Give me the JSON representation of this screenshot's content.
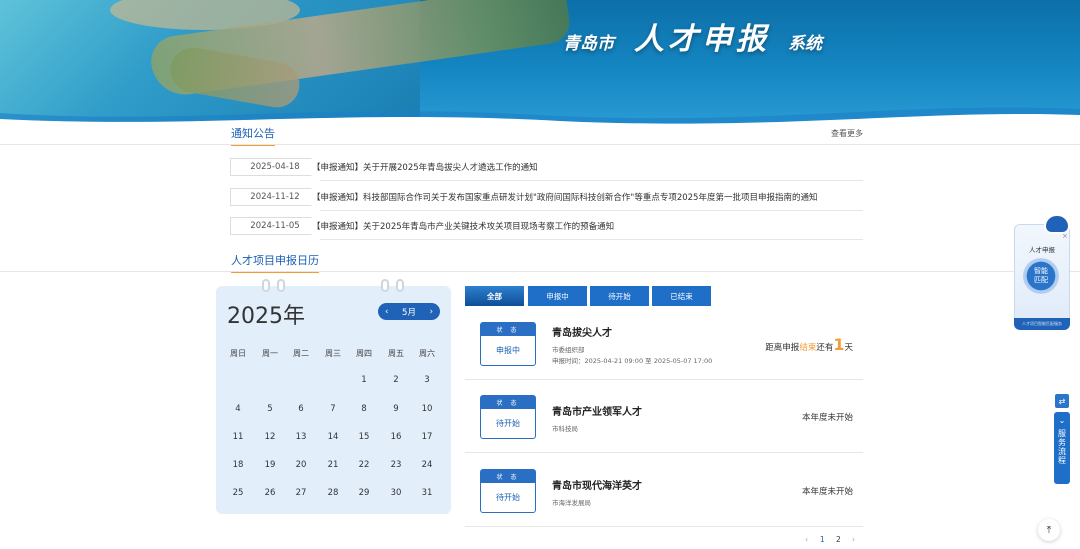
{
  "banner": {
    "city": "青岛市",
    "main": "人才申报",
    "system": "系统"
  },
  "notices": {
    "title": "通知公告",
    "more": "查看更多",
    "items": [
      {
        "date": "2025-04-18",
        "text": "【申报通知】关于开展2025年青岛拔尖人才遴选工作的通知"
      },
      {
        "date": "2024-11-12",
        "text": "【申报通知】科技部国际合作司关于发布国家重点研发计划\"政府间国际科技创新合作\"等重点专项2025年度第一批项目申报指南的通知"
      },
      {
        "date": "2024-11-05",
        "text": "【申报通知】关于2025年青岛市产业关键技术攻关项目现场考察工作的预备通知"
      }
    ]
  },
  "calendar": {
    "title": "人才项目申报日历",
    "year": "2025年",
    "month": "5月",
    "prev": "‹",
    "next": "›",
    "weekdays": [
      "周日",
      "周一",
      "周二",
      "周三",
      "周四",
      "周五",
      "周六"
    ],
    "days": [
      "1",
      "2",
      "3",
      "4",
      "5",
      "6",
      "7",
      "8",
      "9",
      "10",
      "11",
      "12",
      "13",
      "14",
      "15",
      "16",
      "17",
      "18",
      "19",
      "20",
      "21",
      "22",
      "23",
      "24",
      "25",
      "26",
      "27",
      "28",
      "29",
      "30",
      "31"
    ]
  },
  "tabs": [
    "全部",
    "申报中",
    "待开始",
    "已结束"
  ],
  "projects": [
    {
      "status_label": "状 态",
      "status": "申报中",
      "name": "青岛拔尖人才",
      "org": "市委组织部",
      "time": "申报时间：2025-04-21 09:00 至 2025-05-07 17:00",
      "right_pre": "距离申报",
      "right_hl": "结束",
      "right_mid": "还有",
      "right_num": "1",
      "right_post": "天"
    },
    {
      "status_label": "状 态",
      "status": "待开始",
      "name": "青岛市产业领军人才",
      "org": "市科技局",
      "time": "",
      "right_text": "本年度未开始"
    },
    {
      "status_label": "状 态",
      "status": "待开始",
      "name": "青岛市现代海洋英才",
      "org": "市海洋发展局",
      "time": "",
      "right_text": "本年度未开始"
    }
  ],
  "pager": {
    "prev": "‹",
    "pages": [
      "1",
      "2"
    ],
    "next": "›"
  },
  "float_card": {
    "title": "人才申报",
    "match": "智能\n匹配",
    "foot": "人才项目智能匹配服务"
  },
  "service": {
    "label": "服务流程"
  },
  "colors": {
    "primary": "#1f62b7",
    "accent": "#f39c35"
  },
  "icons": {
    "chevron": "chevron-down-icon",
    "back_to_top": "arrow-up-icon",
    "close": "close-icon"
  }
}
